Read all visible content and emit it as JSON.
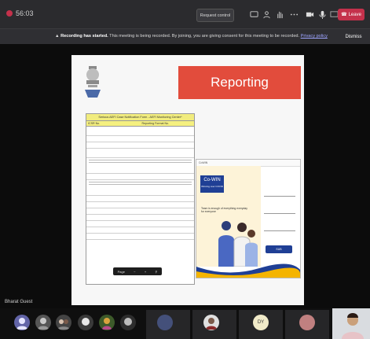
{
  "window": {
    "timer": "56:03",
    "request_control_label": "Request control",
    "leave_label": "Leave",
    "colors": {
      "leave": "#c4314b",
      "topbar": "#2b2b2e"
    }
  },
  "banner": {
    "bold": "Recording has started.",
    "text": " This meeting is being recorded. By joining, you are giving consent for this meeting to be recorded.",
    "link": "Privacy policy",
    "dismiss_label": "Dismiss"
  },
  "slide": {
    "title": "Reporting",
    "title_color": "#e24c3c",
    "form": {
      "heading": "Serious AEFI Case Notification Form - AEFI Monitoring Center*",
      "col1": "ICSR No.",
      "col2": "Reporting Format No."
    },
    "cowin": {
      "header": "CoWIN",
      "logo_main": "Co-WIN",
      "logo_sub": "Winning over COVID",
      "tagline": "Team is enough of everything everyday for everyone",
      "submit_label": "SUB"
    },
    "pdf_page": "Page"
  },
  "participants": {
    "name_tag": "Bharat Guest",
    "initials_1": "DY"
  }
}
